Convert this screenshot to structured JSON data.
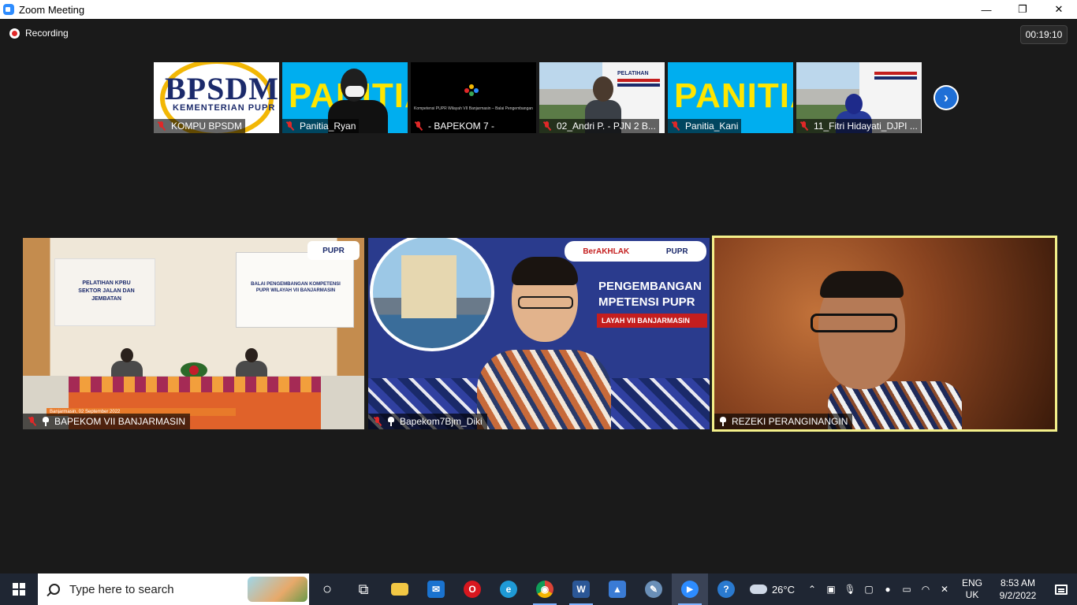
{
  "window": {
    "title": "Zoom Meeting",
    "controls": {
      "minimize": "—",
      "restore": "❐",
      "close": "✕"
    }
  },
  "meeting": {
    "recording_label": "Recording",
    "elapsed": "00:19:10"
  },
  "thumbnails": [
    {
      "name": "KOMPU BPSDM",
      "logo_text": "BPSDM",
      "logo_sub": "KEMENTERIAN PUPR",
      "mic_muted": true
    },
    {
      "name": "Panitia_Ryan",
      "banner": "PANITIA",
      "mic_muted": true
    },
    {
      "name": "- BAPEKOM 7 -",
      "caption": "Kompetensi PUPR Wilayah VII Banjarmasin – Balai Pengembangan",
      "mic_muted": true
    },
    {
      "name": "02_Andri P. - PJN 2 B...",
      "panel_title": "PELATIHAN",
      "mic_muted": true
    },
    {
      "name": "Panitia_Kani",
      "banner": "PANITIA",
      "mic_muted": true
    },
    {
      "name": "11_Fitri Hidayati_DJPI ...",
      "mic_muted": true
    }
  ],
  "main_tiles": [
    {
      "name": "BAPEKOM VII BANJARMASIN",
      "mic_muted": true,
      "pinned": true,
      "banner_text": "PELATIHAN KPBU SEKTOR JALAN DAN JEMBATAN",
      "screen_text": "BALAI PENGEMBANGAN KOMPETENSI PUPR WILAYAH VII BANJARMASIN",
      "date_caption": "Banjarmasin, 02 September 2022",
      "badge": "PUPR"
    },
    {
      "name": "Bapekom7Bjm_Diki",
      "mic_muted": true,
      "pinned": true,
      "header_left": "BerAKHLAK",
      "header_right": "PUPR",
      "title_line1": "PENGEMBANGAN",
      "title_line2": "MPETENSI PUPR",
      "red_tag": "LAYAH VII BANJARMASIN"
    },
    {
      "name": "REZEKI PERANGINANGIN",
      "mic_muted": false,
      "pinned": true,
      "active_speaker": true
    }
  ],
  "taskbar": {
    "search_placeholder": "Type here to search",
    "apps": [
      {
        "name": "cortana",
        "label": "○"
      },
      {
        "name": "task-view",
        "label": "⧉"
      },
      {
        "name": "file-explorer",
        "label": ""
      },
      {
        "name": "mail",
        "label": "✉"
      },
      {
        "name": "opera",
        "label": "O"
      },
      {
        "name": "edge",
        "label": "e"
      },
      {
        "name": "chrome",
        "label": "◉"
      },
      {
        "name": "word",
        "label": "W"
      },
      {
        "name": "photos",
        "label": "▲"
      },
      {
        "name": "paint",
        "label": "✎"
      },
      {
        "name": "zoom",
        "label": "▶"
      },
      {
        "name": "help",
        "label": "?"
      }
    ],
    "weather": "26°C",
    "language_line1": "ENG",
    "language_line2": "UK",
    "time": "8:53 AM",
    "date": "9/2/2022"
  },
  "colors": {
    "background": "#1a1a1a",
    "active_speaker_border": "#f4f08a",
    "muted_red": "#e02828",
    "zoom_blue": "#2d8cff",
    "taskbar": "#1f2633"
  }
}
